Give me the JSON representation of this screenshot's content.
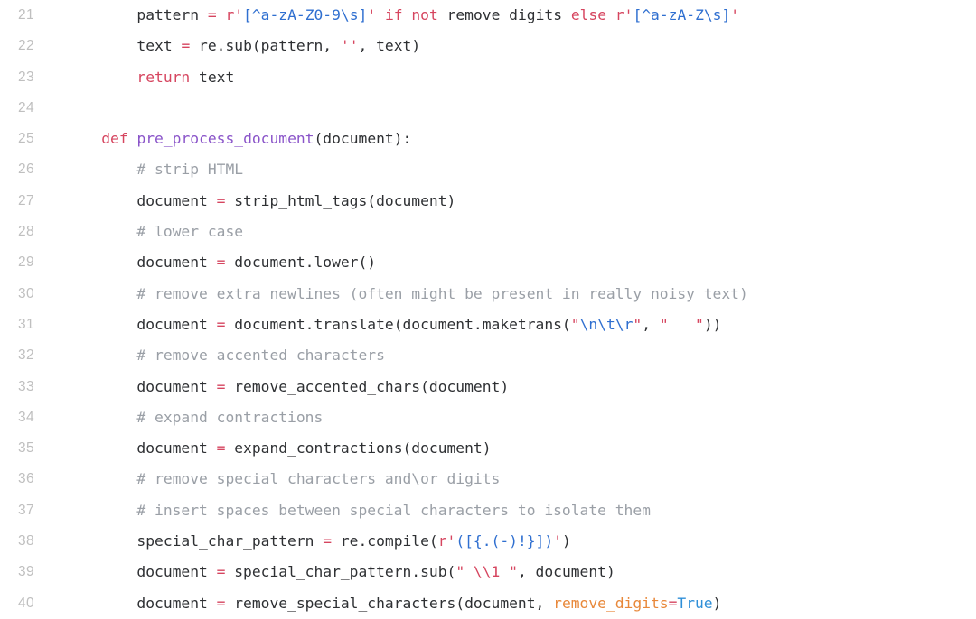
{
  "editor": {
    "language": "Python",
    "theme": "light",
    "background": "#ffffff",
    "gutter_color": "#bfbfbf",
    "first_visible_line": 21,
    "last_visible_line": 40,
    "colors": {
      "plain": "#2e3033",
      "keyword": "#d6455f",
      "operator": "#d6455f",
      "comment": "#9a9fa6",
      "string": "#d6455f",
      "regex": "#2f6fd0",
      "function_def": "#8a54c9",
      "keyword_arg": "#e8883a",
      "builtin": "#2f8fd8"
    }
  },
  "code": {
    "lines": [
      {
        "number": "21",
        "text": "        pattern = r'[^a-zA-Z0-9\\s]' if not remove_digits else r'[^a-zA-Z\\s]'",
        "tokens": [
          {
            "t": "        pattern ",
            "c": "plain"
          },
          {
            "t": "=",
            "c": "operator"
          },
          {
            "t": " ",
            "c": "plain"
          },
          {
            "t": "r'",
            "c": "string"
          },
          {
            "t": "[^a-zA-Z0-9\\s]",
            "c": "regex"
          },
          {
            "t": "'",
            "c": "string"
          },
          {
            "t": " ",
            "c": "plain"
          },
          {
            "t": "if not",
            "c": "keyword"
          },
          {
            "t": " remove_digits ",
            "c": "plain"
          },
          {
            "t": "else",
            "c": "keyword"
          },
          {
            "t": " ",
            "c": "plain"
          },
          {
            "t": "r'",
            "c": "string"
          },
          {
            "t": "[^a-zA-Z\\s]",
            "c": "regex"
          },
          {
            "t": "'",
            "c": "string"
          }
        ]
      },
      {
        "number": "22",
        "text": "        text = re.sub(pattern, '', text)",
        "tokens": [
          {
            "t": "        text ",
            "c": "plain"
          },
          {
            "t": "=",
            "c": "operator"
          },
          {
            "t": " re.sub(pattern, ",
            "c": "plain"
          },
          {
            "t": "''",
            "c": "string"
          },
          {
            "t": ", text)",
            "c": "plain"
          }
        ]
      },
      {
        "number": "23",
        "text": "        return text",
        "tokens": [
          {
            "t": "        ",
            "c": "plain"
          },
          {
            "t": "return",
            "c": "keyword"
          },
          {
            "t": " text",
            "c": "plain"
          }
        ]
      },
      {
        "number": "24",
        "text": "",
        "tokens": []
      },
      {
        "number": "25",
        "text": "    def pre_process_document(document):",
        "tokens": [
          {
            "t": "    ",
            "c": "plain"
          },
          {
            "t": "def",
            "c": "keyword"
          },
          {
            "t": " ",
            "c": "plain"
          },
          {
            "t": "pre_process_document",
            "c": "function_def"
          },
          {
            "t": "(document):",
            "c": "plain"
          }
        ]
      },
      {
        "number": "26",
        "text": "        # strip HTML",
        "tokens": [
          {
            "t": "        ",
            "c": "plain"
          },
          {
            "t": "# strip HTML",
            "c": "comment"
          }
        ]
      },
      {
        "number": "27",
        "text": "        document = strip_html_tags(document)",
        "tokens": [
          {
            "t": "        document ",
            "c": "plain"
          },
          {
            "t": "=",
            "c": "operator"
          },
          {
            "t": " strip_html_tags(document)",
            "c": "plain"
          }
        ]
      },
      {
        "number": "28",
        "text": "        # lower case",
        "tokens": [
          {
            "t": "        ",
            "c": "plain"
          },
          {
            "t": "# lower case",
            "c": "comment"
          }
        ]
      },
      {
        "number": "29",
        "text": "        document = document.lower()",
        "tokens": [
          {
            "t": "        document ",
            "c": "plain"
          },
          {
            "t": "=",
            "c": "operator"
          },
          {
            "t": " document.lower()",
            "c": "plain"
          }
        ]
      },
      {
        "number": "30",
        "text": "        # remove extra newlines (often might be present in really noisy text)",
        "tokens": [
          {
            "t": "        ",
            "c": "plain"
          },
          {
            "t": "# remove extra newlines (often might be present in really noisy text)",
            "c": "comment"
          }
        ]
      },
      {
        "number": "31",
        "text": "        document = document.translate(document.maketrans(\"\\n\\t\\r\", \"   \"))",
        "tokens": [
          {
            "t": "        document ",
            "c": "plain"
          },
          {
            "t": "=",
            "c": "operator"
          },
          {
            "t": " document.translate(document.maketrans(",
            "c": "plain"
          },
          {
            "t": "\"",
            "c": "string"
          },
          {
            "t": "\\n\\t\\r",
            "c": "regex"
          },
          {
            "t": "\"",
            "c": "string"
          },
          {
            "t": ", ",
            "c": "plain"
          },
          {
            "t": "\"   \"",
            "c": "string"
          },
          {
            "t": "))",
            "c": "plain"
          }
        ]
      },
      {
        "number": "32",
        "text": "        # remove accented characters",
        "tokens": [
          {
            "t": "        ",
            "c": "plain"
          },
          {
            "t": "# remove accented characters",
            "c": "comment"
          }
        ]
      },
      {
        "number": "33",
        "text": "        document = remove_accented_chars(document)",
        "tokens": [
          {
            "t": "        document ",
            "c": "plain"
          },
          {
            "t": "=",
            "c": "operator"
          },
          {
            "t": " remove_accented_chars(document)",
            "c": "plain"
          }
        ]
      },
      {
        "number": "34",
        "text": "        # expand contractions",
        "tokens": [
          {
            "t": "        ",
            "c": "plain"
          },
          {
            "t": "# expand contractions",
            "c": "comment"
          }
        ]
      },
      {
        "number": "35",
        "text": "        document = expand_contractions(document)",
        "tokens": [
          {
            "t": "        document ",
            "c": "plain"
          },
          {
            "t": "=",
            "c": "operator"
          },
          {
            "t": " expand_contractions(document)",
            "c": "plain"
          }
        ]
      },
      {
        "number": "36",
        "text": "        # remove special characters and\\or digits",
        "tokens": [
          {
            "t": "        ",
            "c": "plain"
          },
          {
            "t": "# remove special characters and\\or digits",
            "c": "comment"
          }
        ]
      },
      {
        "number": "37",
        "text": "        # insert spaces between special characters to isolate them",
        "tokens": [
          {
            "t": "        ",
            "c": "plain"
          },
          {
            "t": "# insert spaces between special characters to isolate them",
            "c": "comment"
          }
        ]
      },
      {
        "number": "38",
        "text": "        special_char_pattern = re.compile(r'([{.(-)!}])')",
        "tokens": [
          {
            "t": "        special_char_pattern ",
            "c": "plain"
          },
          {
            "t": "=",
            "c": "operator"
          },
          {
            "t": " re.compile(",
            "c": "plain"
          },
          {
            "t": "r'",
            "c": "string"
          },
          {
            "t": "([{.(-)!}])",
            "c": "regex"
          },
          {
            "t": "'",
            "c": "string"
          },
          {
            "t": ")",
            "c": "plain"
          }
        ]
      },
      {
        "number": "39",
        "text": "        document = special_char_pattern.sub(\" \\\\1 \", document)",
        "tokens": [
          {
            "t": "        document ",
            "c": "plain"
          },
          {
            "t": "=",
            "c": "operator"
          },
          {
            "t": " special_char_pattern.sub(",
            "c": "plain"
          },
          {
            "t": "\" \\\\1 \"",
            "c": "string"
          },
          {
            "t": ", document)",
            "c": "plain"
          }
        ]
      },
      {
        "number": "40",
        "text": "        document = remove_special_characters(document, remove_digits=True)",
        "tokens": [
          {
            "t": "        document ",
            "c": "plain"
          },
          {
            "t": "=",
            "c": "operator"
          },
          {
            "t": " remove_special_characters(document, ",
            "c": "plain"
          },
          {
            "t": "remove_digits",
            "c": "keyword_arg"
          },
          {
            "t": "=",
            "c": "operator"
          },
          {
            "t": "True",
            "c": "builtin"
          },
          {
            "t": ")",
            "c": "plain"
          }
        ]
      }
    ]
  }
}
